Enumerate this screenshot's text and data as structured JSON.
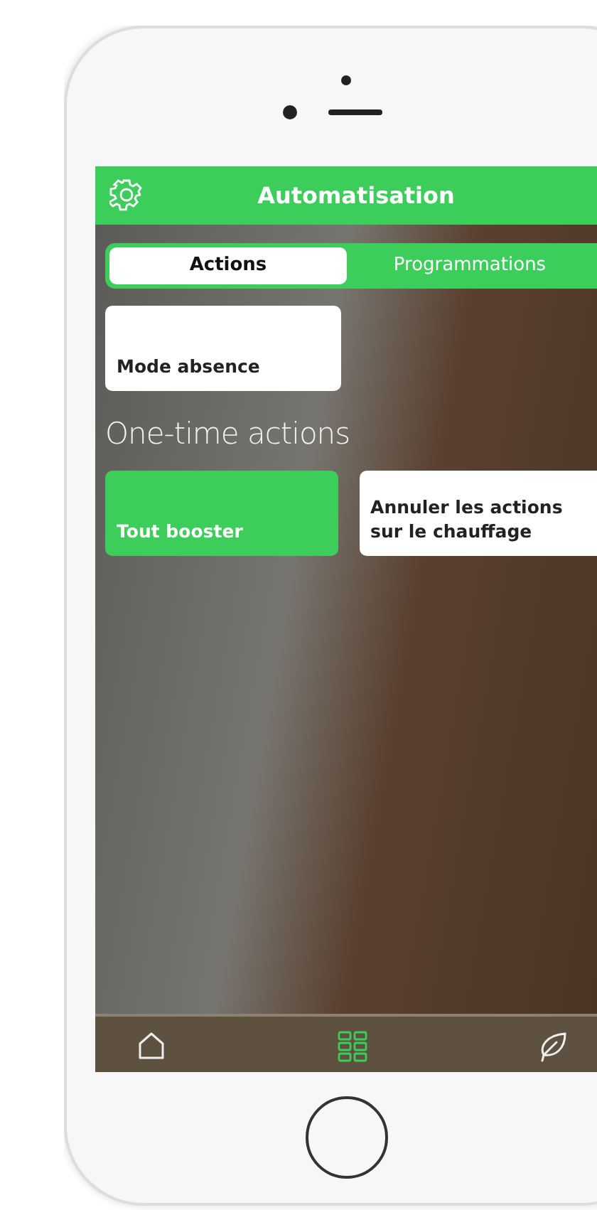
{
  "header": {
    "title": "Automatisation"
  },
  "tabs": [
    {
      "label": "Actions",
      "selected": true
    },
    {
      "label": "Programmations",
      "selected": false
    }
  ],
  "actions": [
    {
      "label": "Mode absence",
      "active": false
    }
  ],
  "section": {
    "title": "One-time actions"
  },
  "one_time_actions": [
    {
      "label": "Tout booster",
      "active": true
    },
    {
      "label": "Annuler les actions sur le chauffage",
      "active": false
    }
  ],
  "nav": [
    {
      "kind": "home",
      "selected": false
    },
    {
      "kind": "grid",
      "selected": true
    },
    {
      "kind": "leaf",
      "selected": false
    }
  ]
}
